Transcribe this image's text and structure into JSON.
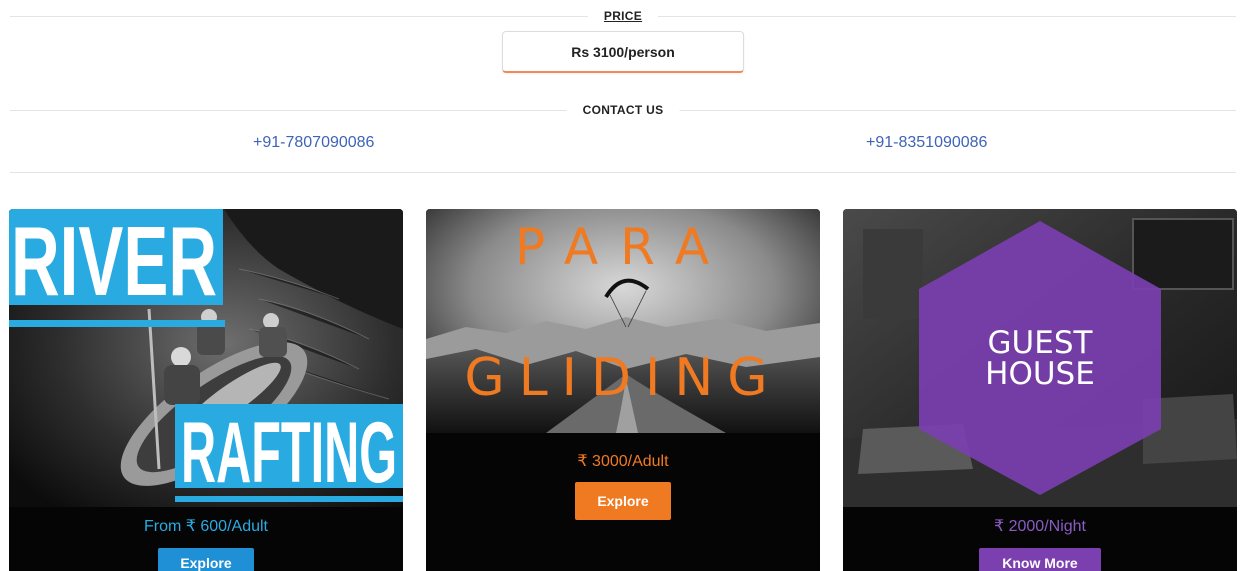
{
  "price_section": {
    "label": "PRICE",
    "value": "Rs 3100/person"
  },
  "contact_section": {
    "label": "CONTACT US",
    "phones": [
      "+91-7807090086",
      "+91-8351090086"
    ]
  },
  "cards": [
    {
      "title_line1": "RIVER",
      "title_line2": "RAFTING",
      "price": "From ₹ 600/Adult",
      "button": "Explore",
      "accent": "#29abe2"
    },
    {
      "title_line1": "PARA",
      "title_line2": "GLIDING",
      "price": "₹ 3000/Adult",
      "button": "Explore",
      "accent": "#f07a22"
    },
    {
      "title_line1": "GUEST",
      "title_line2": "HOUSE",
      "price": "₹ 2000/Night",
      "button": "Know More",
      "accent": "#7b3fb0"
    }
  ]
}
